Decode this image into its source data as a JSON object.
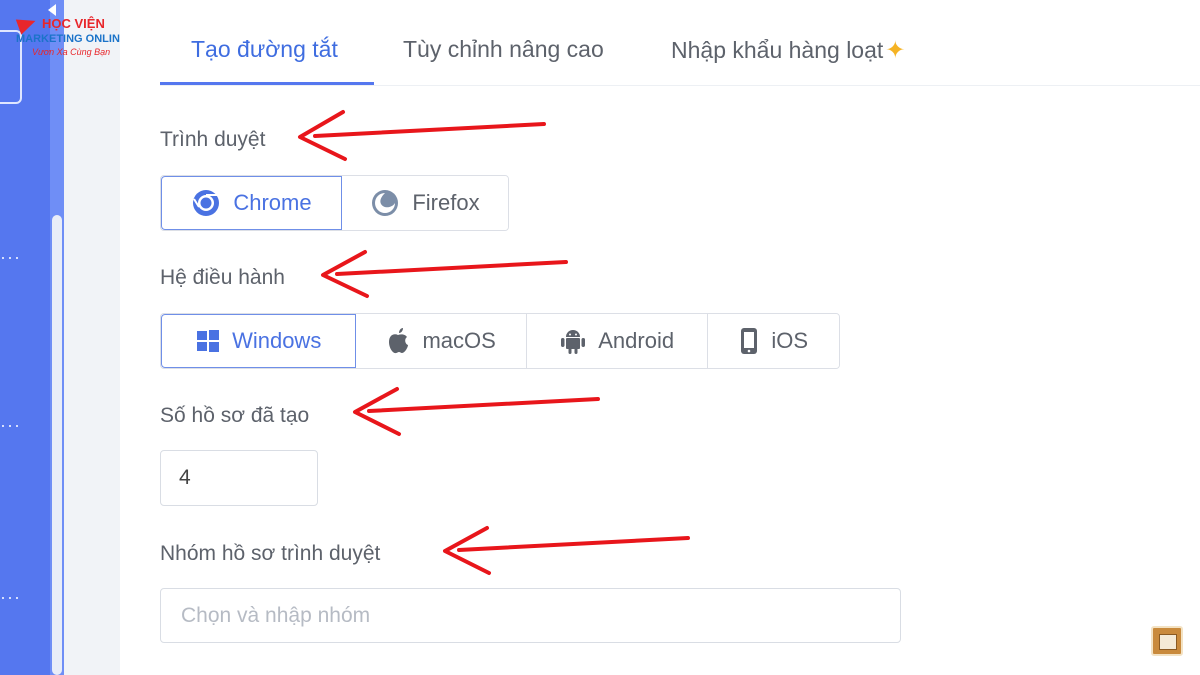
{
  "logo": {
    "line1": "HỌC VIỆN",
    "line2": "MARKETING ONLINE",
    "line3": "Vươn Xa Cùng Bạn"
  },
  "tabs": [
    {
      "label": "Tạo đường tắt",
      "active": true
    },
    {
      "label": "Tùy chỉnh nâng cao",
      "active": false
    },
    {
      "label": "Nhập khẩu hàng loạt",
      "active": false
    }
  ],
  "browser": {
    "label": "Trình duyệt",
    "options": [
      {
        "label": "Chrome",
        "icon": "chrome-icon",
        "selected": true
      },
      {
        "label": "Firefox",
        "icon": "firefox-icon",
        "selected": false
      }
    ]
  },
  "os": {
    "label": "Hệ điều hành",
    "options": [
      {
        "label": "Windows",
        "icon": "windows-icon",
        "selected": true
      },
      {
        "label": "macOS",
        "icon": "apple-icon",
        "selected": false
      },
      {
        "label": "Android",
        "icon": "android-icon",
        "selected": false
      },
      {
        "label": "iOS",
        "icon": "ios-device-icon",
        "selected": false
      }
    ]
  },
  "profiles_created": {
    "label": "Số hồ sơ đã tạo",
    "value": "4"
  },
  "profile_group": {
    "label": "Nhóm hồ sơ trình duyệt",
    "placeholder": "Chọn và nhập nhóm"
  },
  "colors": {
    "accent": "#5577ef",
    "sidebar": "#5577ef",
    "annotation_arrow": "#e8161b",
    "sparkle": "#f5b324"
  }
}
